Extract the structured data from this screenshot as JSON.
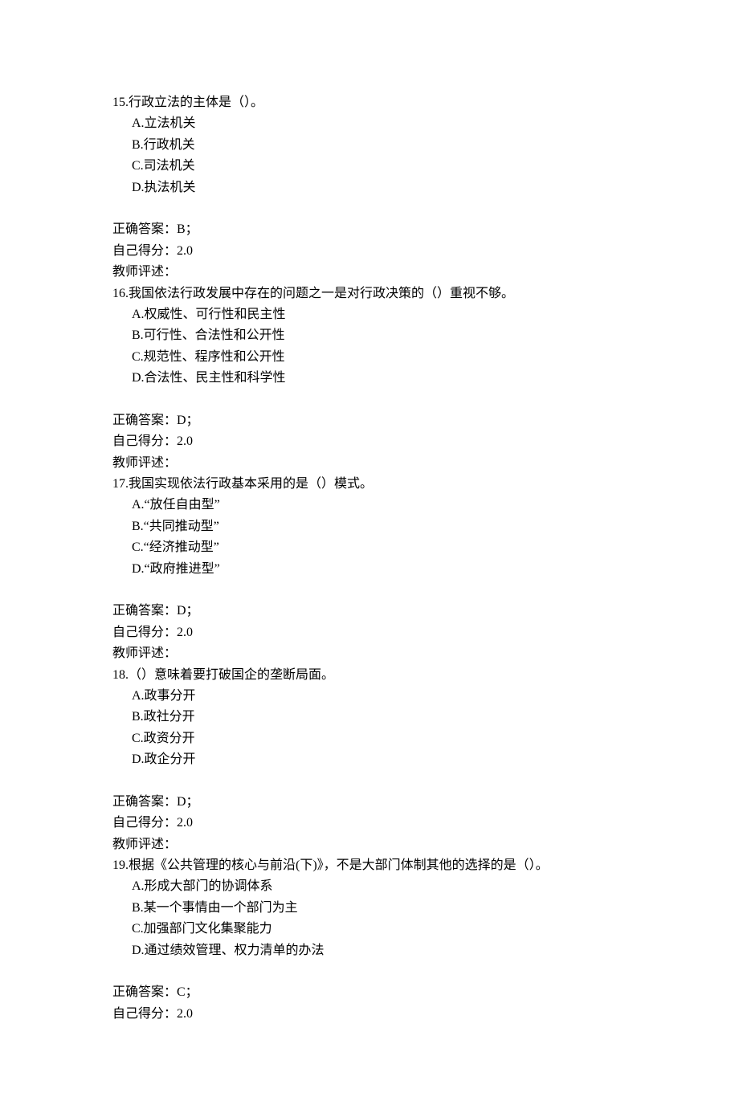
{
  "questions": [
    {
      "number": "15.",
      "text": "行政立法的主体是（）。",
      "options": [
        "A.立法机关",
        "B.行政机关",
        "C.司法机关",
        "D.执法机关"
      ],
      "answer": "正确答案：B；",
      "score": "自己得分：2.0",
      "teacher": "教师评述："
    },
    {
      "number": "16.",
      "text": "我国依法行政发展中存在的问题之一是对行政决策的（）重视不够。",
      "options": [
        "A.权威性、可行性和民主性",
        "B.可行性、合法性和公开性",
        "C.规范性、程序性和公开性",
        "D.合法性、民主性和科学性"
      ],
      "answer": "正确答案：D；",
      "score": "自己得分：2.0",
      "teacher": "教师评述："
    },
    {
      "number": "17.",
      "text": "我国实现依法行政基本采用的是（）模式。",
      "options": [
        "A.“放任自由型”",
        "B.“共同推动型”",
        "C.“经济推动型”",
        "D.“政府推进型”"
      ],
      "answer": "正确答案：D；",
      "score": "自己得分：2.0",
      "teacher": "教师评述："
    },
    {
      "number": "18.",
      "text": "（）意味着要打破国企的垄断局面。",
      "options": [
        "A.政事分开",
        "B.政社分开",
        "C.政资分开",
        "D.政企分开"
      ],
      "answer": "正确答案：D；",
      "score": "自己得分：2.0",
      "teacher": "教师评述："
    },
    {
      "number": "19.",
      "text": "根据《公共管理的核心与前沿(下)》，不是大部门体制其他的选择的是（）。",
      "options": [
        "A.形成大部门的协调体系",
        "B.某一个事情由一个部门为主",
        "C.加强部门文化集聚能力",
        "D.通过绩效管理、权力清单的办法"
      ],
      "answer": "正确答案：C；",
      "score": "自己得分：2.0",
      "teacher": null
    }
  ]
}
